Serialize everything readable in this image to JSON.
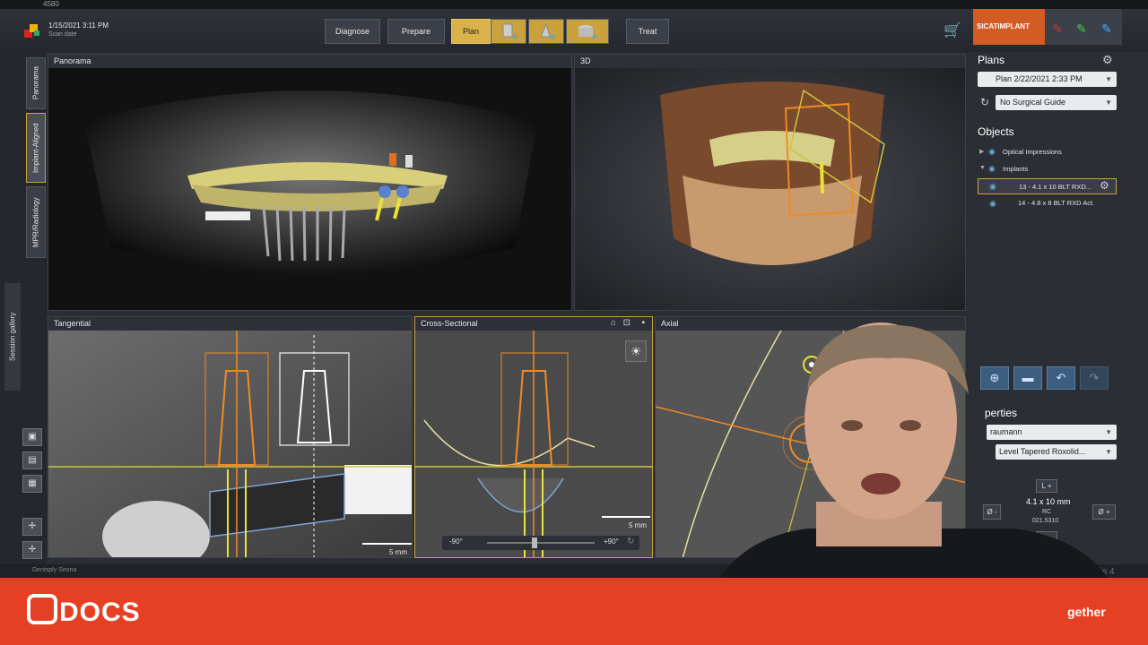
{
  "window": {
    "id_text": "4580"
  },
  "scan": {
    "date": "1/15/2021 3:11 PM",
    "label": "Scan date"
  },
  "workflow": {
    "diagnose": "Diagnose",
    "prepare": "Prepare",
    "plan": "Plan",
    "treat": "Treat"
  },
  "brand": {
    "sicat": "SICATIMPLANT"
  },
  "left_tabs": {
    "panorama": "Panorama",
    "implant_aligned": "Implant-Aligned",
    "mpr": "MPR/Radiology",
    "session": "Session gallery"
  },
  "views": {
    "panorama": "Panorama",
    "three_d": "3D",
    "tangential": "Tangential",
    "cross_sectional": "Cross-Sectional",
    "axial": "Axial"
  },
  "scales": {
    "tangential": "5 mm",
    "cross": "5 mm"
  },
  "slider": {
    "min": "-90°",
    "max": "+90°"
  },
  "plans": {
    "title": "Plans",
    "plan_select": "Plan 2/22/2021 2:33 PM",
    "guide_select": "No Surgical Guide"
  },
  "objects": {
    "title": "Objects",
    "optical": "Optical Impressions",
    "implants": "Implants",
    "implant_1": "13 - 4.1 x 10 BLT RXD...",
    "implant_2": "14 - 4.8 x 8 BLT RXD Act."
  },
  "properties": {
    "title": "Properties",
    "visible_title": "perties",
    "manufacturer": "raumann",
    "line": "Level Tapered Roxolid...",
    "size": "4.1 x 10 mm",
    "code1": "RC",
    "code2": "021.5310",
    "l_plus": "L +",
    "l_minus": "L -",
    "d_plus": "Ø +",
    "d_minus": "Ø -"
  },
  "footer": {
    "dentsply": "Dentsply Sirona",
    "sidexis": "Sidexis 4"
  },
  "banner": {
    "logo": "DOCS",
    "tagline": "gether"
  },
  "colors": {
    "accent": "#c9a23e",
    "banner": "#e53f24",
    "implant_orange": "#f08a24",
    "yellow_line": "#e8e23a",
    "blue_outline": "#7fa6d6"
  }
}
